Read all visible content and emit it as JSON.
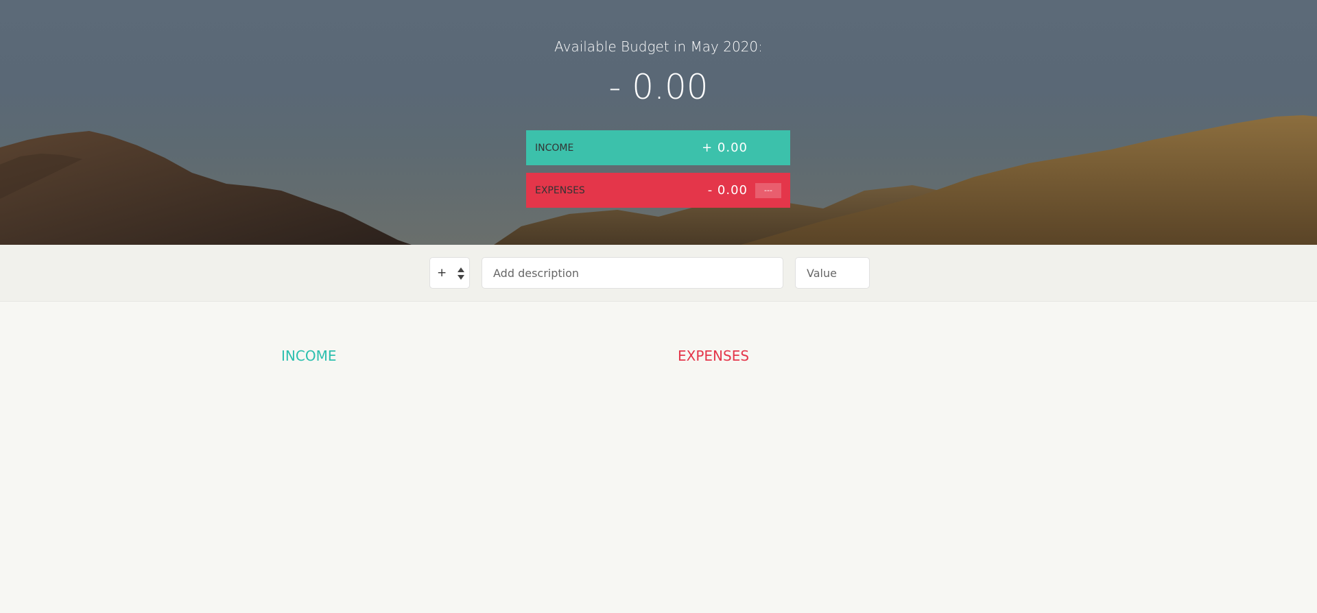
{
  "header": {
    "budget_title": "Available Budget in May 2020:",
    "budget_value": "- 0.00"
  },
  "summary": {
    "income": {
      "label": "INCOME",
      "value": "+ 0.00"
    },
    "expenses": {
      "label": "EXPENSES",
      "value": "- 0.00",
      "percentage": "---"
    }
  },
  "add_form": {
    "type_selected": "+",
    "description_placeholder": "Add description",
    "value_placeholder": "Value"
  },
  "lists": {
    "income_title": "INCOME",
    "expenses_title": "EXPENSES"
  },
  "colors": {
    "income": "#3cc1ab",
    "expenses": "#e4364a"
  },
  "icons": {
    "type_select_arrows": "up-down-arrows-icon",
    "background": "mountain-landscape"
  }
}
